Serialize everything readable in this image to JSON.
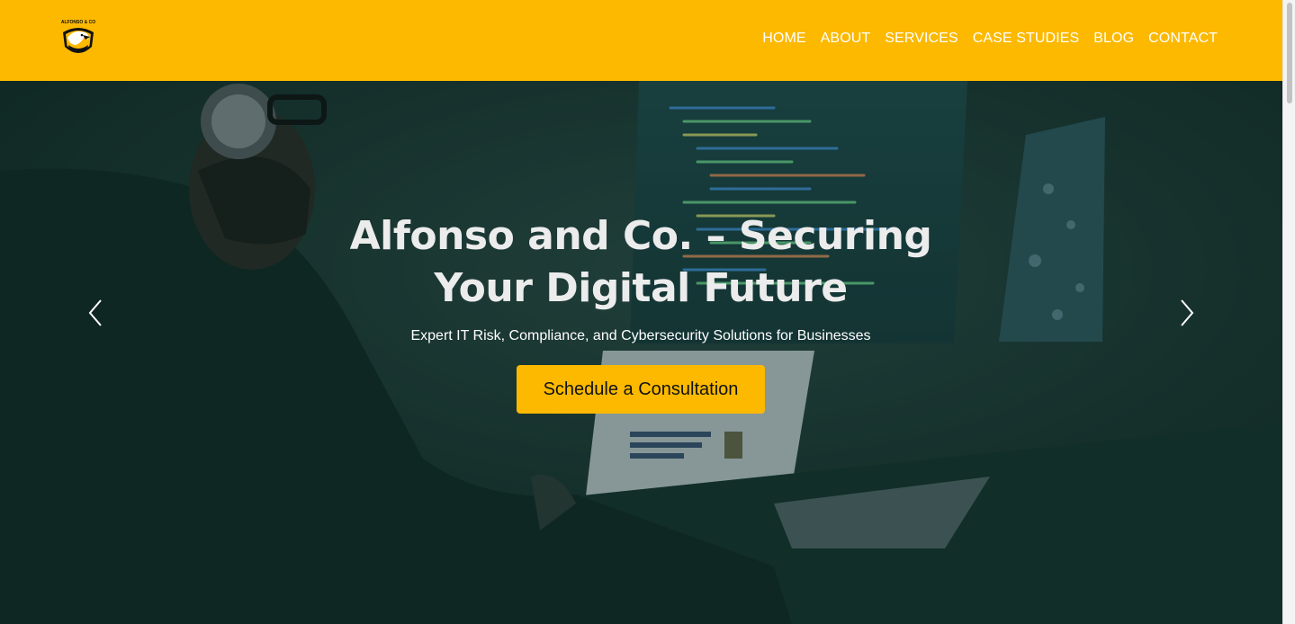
{
  "brand": {
    "logo_icon": "eagle-shield-logo",
    "logo_text": "ALFONSO & CO",
    "accent_color": "#fcb900"
  },
  "nav": {
    "items": [
      {
        "label": "HOME"
      },
      {
        "label": "ABOUT"
      },
      {
        "label": "SERVICES"
      },
      {
        "label": "CASE STUDIES"
      },
      {
        "label": "BLOG"
      },
      {
        "label": "CONTACT"
      }
    ]
  },
  "hero": {
    "title": "Alfonso and Co. – Securing Your Digital Future",
    "subtitle": "Expert IT Risk, Compliance, and Cybersecurity Solutions for Businesses",
    "cta_label": "Schedule a Consultation",
    "prev_icon": "chevron-left-icon",
    "next_icon": "chevron-right-icon"
  }
}
